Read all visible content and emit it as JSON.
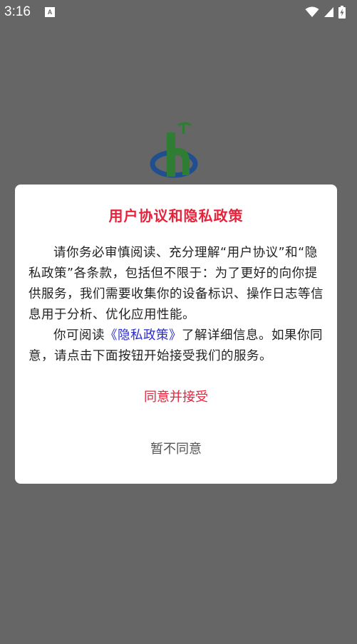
{
  "status_bar": {
    "time": "3:16",
    "notification_icon": "A",
    "icons": [
      "wifi-icon",
      "cell-signal-icon",
      "battery-charging-icon"
    ]
  },
  "dialog": {
    "title": "用户协议和隐私政策",
    "paragraph1": "请你务必审慎阅读、充分理解“用户协议”和“隐私政策”各条款，包括但不限于：为了更好的向你提供服务，我们需要收集你的设备标识、操作日志等信息用于分析、优化应用性能。",
    "paragraph2_prefix": "你可阅读",
    "privacy_link": "《隐私政策》",
    "paragraph2_suffix": "了解详细信息。如果你同意，请点击下面按钮开始接受我们的服务。",
    "agree_label": "同意并接受",
    "disagree_label": "暂不同意"
  },
  "colors": {
    "overlay": "#666666",
    "title_red": "#e8223a",
    "link_blue": "#2a2acb",
    "logo_green": "#2e7d32",
    "logo_blue": "#1f4f8f"
  }
}
